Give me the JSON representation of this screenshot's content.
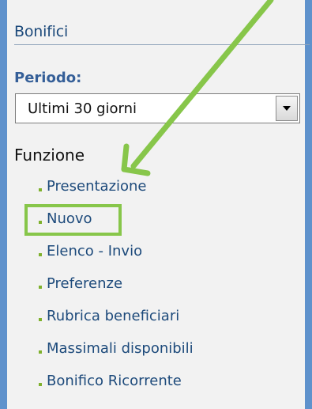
{
  "header": {
    "title": "Bonifici"
  },
  "period": {
    "label": "Periodo:",
    "selected": "Ultimi 30 giorni"
  },
  "functions": {
    "title": "Funzione",
    "items": [
      {
        "label": "Presentazione"
      },
      {
        "label": "Nuovo"
      },
      {
        "label": "Elenco - Invio"
      },
      {
        "label": "Preferenze"
      },
      {
        "label": "Rubrica beneficiari"
      },
      {
        "label": "Massimali disponibili"
      },
      {
        "label": "Bonifico Ricorrente"
      }
    ]
  },
  "colors": {
    "background": "#5f92cc",
    "panel": "#f2f2f2",
    "title": "#1d4a7b",
    "periodLabel": "#355f98",
    "bullet": "#7fb12d",
    "highlight": "#87c64a"
  }
}
